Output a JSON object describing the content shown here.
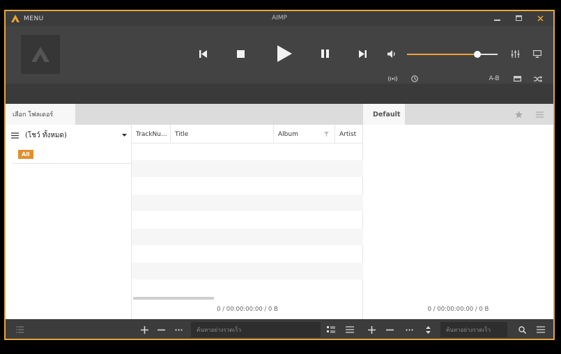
{
  "titlebar": {
    "menu_label": "MENU",
    "app_title": "AIMP",
    "minimize_icon": "minimize-icon",
    "maximize_icon": "maximize-icon",
    "close_icon": "close-icon"
  },
  "player": {
    "cover_icon": "aimp-logo-icon",
    "buttons": [
      "previous-icon",
      "stop-icon",
      "play-icon",
      "pause-icon",
      "next-icon"
    ],
    "volume": 0.78,
    "ab_label": "A-B",
    "icons": [
      "volume-icon",
      "equalizer-icon",
      "display-icon",
      "radio-icon",
      "clock-icon",
      "repeat-icon",
      "shuffle-icon"
    ]
  },
  "tabs": {
    "folder_tab": "เลือก โฟลเดอร์",
    "playlist_tab": "Default"
  },
  "left": {
    "folder_select": "(โชว์ ทั้งหมด)",
    "all_badge": "All"
  },
  "table": {
    "columns": [
      "TrackNu...",
      "Title",
      "Album",
      "Artist"
    ],
    "status": "0 / 00:00:00:00 / 0 B"
  },
  "right": {
    "status": "0 / 00:00:00:00 / 0 B"
  },
  "bottom": {
    "search_placeholder_left": "ค้นหาอย่างรวดเร็ว",
    "search_placeholder_right": "ค้นหาอย่างรวดเร็ว"
  },
  "colors": {
    "accent": "#e8a63a",
    "dark": "#3c3c3c",
    "player_bg": "#434343"
  }
}
